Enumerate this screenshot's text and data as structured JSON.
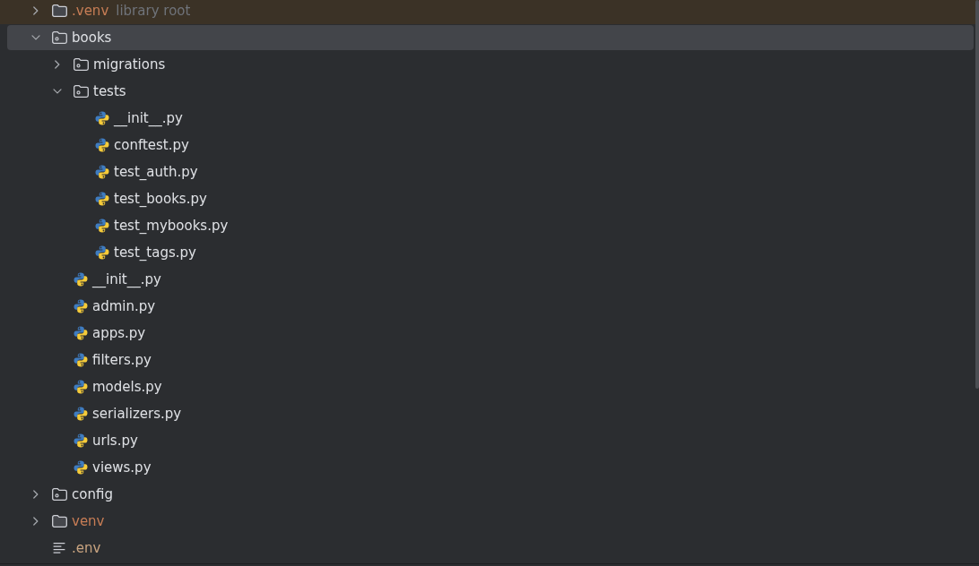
{
  "project_tree": {
    "items": [
      {
        "name": ".venv",
        "hint": "library root",
        "kind": "library_root",
        "color": "#c77d55",
        "expanded": false,
        "selected": false
      },
      {
        "name": "books",
        "kind": "package",
        "color": "#dfe1e5",
        "expanded": true,
        "selected": true,
        "children": [
          {
            "name": "migrations",
            "kind": "package",
            "color": "#dfe1e5",
            "expanded": false,
            "selected": false
          },
          {
            "name": "tests",
            "kind": "package",
            "color": "#dfe1e5",
            "expanded": true,
            "selected": false,
            "children": [
              {
                "name": "__init__.py",
                "kind": "python",
                "color": "#dfe1e5",
                "selected": false
              },
              {
                "name": "conftest.py",
                "kind": "python",
                "color": "#dfe1e5",
                "selected": false
              },
              {
                "name": "test_auth.py",
                "kind": "python",
                "color": "#dfe1e5",
                "selected": false
              },
              {
                "name": "test_books.py",
                "kind": "python",
                "color": "#dfe1e5",
                "selected": false
              },
              {
                "name": "test_mybooks.py",
                "kind": "python",
                "color": "#dfe1e5",
                "selected": false
              },
              {
                "name": "test_tags.py",
                "kind": "python",
                "color": "#dfe1e5",
                "selected": false
              }
            ]
          },
          {
            "name": "__init__.py",
            "kind": "python",
            "color": "#dfe1e5",
            "selected": false
          },
          {
            "name": "admin.py",
            "kind": "python",
            "color": "#dfe1e5",
            "selected": false
          },
          {
            "name": "apps.py",
            "kind": "python",
            "color": "#dfe1e5",
            "selected": false
          },
          {
            "name": "filters.py",
            "kind": "python",
            "color": "#dfe1e5",
            "selected": false
          },
          {
            "name": "models.py",
            "kind": "python",
            "color": "#dfe1e5",
            "selected": false
          },
          {
            "name": "serializers.py",
            "kind": "python",
            "color": "#dfe1e5",
            "selected": false
          },
          {
            "name": "urls.py",
            "kind": "python",
            "color": "#dfe1e5",
            "selected": false
          },
          {
            "name": "views.py",
            "kind": "python",
            "color": "#dfe1e5",
            "selected": false
          }
        ]
      },
      {
        "name": "config",
        "kind": "package",
        "color": "#dfe1e5",
        "expanded": false,
        "selected": false
      },
      {
        "name": "venv",
        "kind": "folder",
        "color": "#c77d55",
        "expanded": false,
        "selected": false
      },
      {
        "name": ".env",
        "kind": "text",
        "color": "#c9a480",
        "selected": false
      }
    ]
  }
}
